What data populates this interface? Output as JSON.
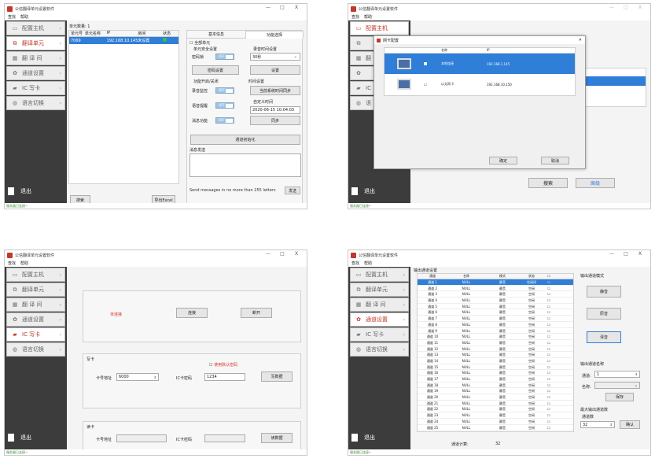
{
  "app": {
    "title": "公信翻译单元设置软件",
    "menu": [
      "查找",
      "帮助"
    ],
    "status": "服务器已连接~",
    "controls": [
      "—",
      "□",
      "X"
    ]
  },
  "sidebar": {
    "items": [
      {
        "label": "配置主机",
        "icon": "monitor-icon"
      },
      {
        "label": "翻译单元",
        "icon": "translate-icon"
      },
      {
        "label": "翻 译 间",
        "icon": "grid-icon"
      },
      {
        "label": "通道设置",
        "icon": "gear-icon"
      },
      {
        "label": "IC 写卡",
        "icon": "card-icon"
      },
      {
        "label": "语言切换",
        "icon": "language-icon"
      }
    ],
    "exit": "退出"
  },
  "p1": {
    "unit_count": "单元数量: 1",
    "columns": [
      "单元号",
      "单元名称",
      "IP",
      "房间",
      "状态"
    ],
    "row": [
      "7069",
      "",
      "192.168.10.145",
      "未设置",
      ""
    ],
    "search_btn": "搜索",
    "export_btn": "导出Excel",
    "tabs": [
      "基本信息",
      "功能选择"
    ],
    "all_units": "全部单元",
    "security_title": "单元安全设置",
    "timeout_title": "录音时间设置",
    "password_label": "密码锁",
    "toggle_off": "OFF",
    "timeout_value": "30秒",
    "pwd_btn": "密码设置",
    "set_btn": "设置",
    "func_title": "功能开启/关闭",
    "time_title": "时间设置",
    "rec_label": "录音监控",
    "sync_sys_btn": "当前系统时间同步",
    "voice_label": "语音提醒",
    "custom_time": "自定义时间",
    "msg_label": "消息功能",
    "datetime": "2020-06-15  10:04:03",
    "sync_btn": "同步",
    "init_btn": "通道初始化",
    "msg_send": "消息发送",
    "msg_hint": "Send messages in no more than 255 letters",
    "send_btn": "发送"
  },
  "p2": {
    "dialog_title": "网卡配置",
    "cols": [
      "",
      "",
      "名称",
      "IP"
    ],
    "rows": [
      {
        "name": "本地连接",
        "ip": "192.168.1.145",
        "checked": true
      },
      {
        "name": "以太网 3",
        "ip": "192.168.10.150",
        "checked": false
      }
    ],
    "ok_btn": "确定",
    "cancel_btn": "取消",
    "search_btn": "搜索",
    "adv_btn": "高级",
    "hidden_labels": [
      "翻",
      "IC",
      "语"
    ]
  },
  "p3": {
    "not_connected": "未连接",
    "connect_btn": "连接",
    "disconnect_btn": "断开",
    "write_title": "写卡",
    "default_pwd": "使用默认密码",
    "card_addr_label": "卡号地址",
    "card_addr_value": "6000",
    "pwd_label": "IC卡密码",
    "pwd_value": "1234",
    "write_btn": "写数据",
    "read_title": "读卡",
    "read_btn": "读数据"
  },
  "p4": {
    "section_title": "输出通道设置",
    "columns": [
      "通道",
      "名称",
      "模式",
      "状态",
      "",
      ""
    ],
    "name_val": "NULL",
    "mode_val": "静音",
    "state_val": "空闲",
    "first_state": "空闲间",
    "channel_prefix": "通道 ",
    "channel_count_label": "通道计算:",
    "channel_count": "32",
    "mode_title": "输出通道模式",
    "mute_btn": "静音",
    "floor_btn": "原音",
    "interp_btn": "译音",
    "name_title": "输出通道名称",
    "ch_label": "通道:",
    "ch_val": "1",
    "name_label": "名称:",
    "save_btn": "保存",
    "max_title": "最大输出通道数",
    "ch_count_label": "通道数",
    "max_val": "32",
    "confirm_btn": "确认"
  }
}
